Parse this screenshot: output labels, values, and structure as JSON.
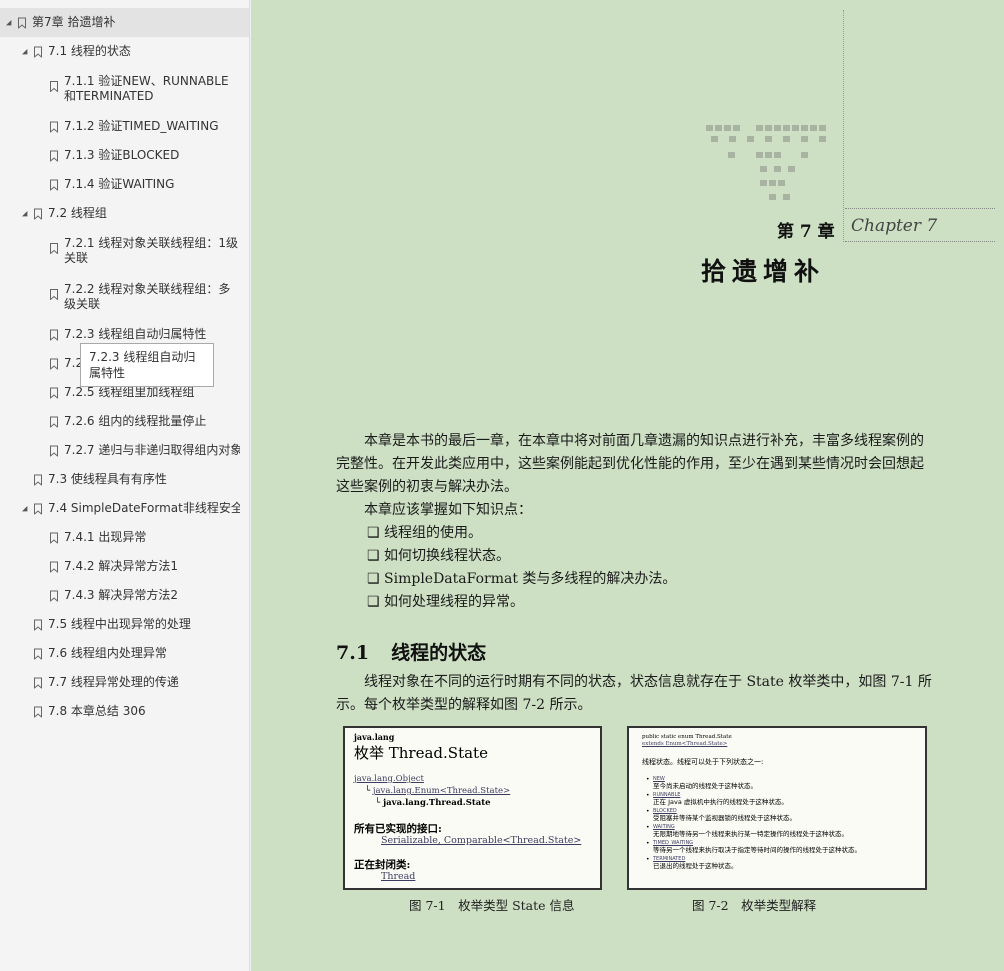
{
  "sidebar": {
    "items": [
      {
        "label": "第7章 拾遗增补",
        "level": 0,
        "expanded": true,
        "selected": true
      },
      {
        "label": "7.1 线程的状态",
        "level": 1,
        "expanded": true
      },
      {
        "label": "7.1.1 验证NEW、RUNNABLE和TERMINATED",
        "level": 2
      },
      {
        "label": "7.1.2 验证TIMED_WAITING",
        "level": 2
      },
      {
        "label": "7.1.3 验证BLOCKED",
        "level": 2
      },
      {
        "label": "7.1.4 验证WAITING",
        "level": 2
      },
      {
        "label": "7.2 线程组",
        "level": 1,
        "expanded": true
      },
      {
        "label": "7.2.1 线程对象关联线程组：1级关联",
        "level": 2
      },
      {
        "label": "7.2.2 线程对象关联线程组：多级关联",
        "level": 2
      },
      {
        "label": "7.2.3 线程组自动归属特性",
        "level": 2
      },
      {
        "label": "7.2.4 获取根线程组",
        "level": 2
      },
      {
        "label": "7.2.5 线程组里加线程组",
        "level": 2
      },
      {
        "label": "7.2.6 组内的线程批量停止",
        "level": 2
      },
      {
        "label": "7.2.7 递归与非递归取得组内对象",
        "level": 2
      },
      {
        "label": "7.3 使线程具有有序性",
        "level": 1
      },
      {
        "label": "7.4 SimpleDateFormat非线程安全",
        "level": 1,
        "expanded": true
      },
      {
        "label": "7.4.1 出现异常",
        "level": 2
      },
      {
        "label": "7.4.2 解决异常方法1",
        "level": 2
      },
      {
        "label": "7.4.3 解决异常方法2",
        "level": 2
      },
      {
        "label": "7.5 线程中出现异常的处理",
        "level": 1
      },
      {
        "label": "7.6 线程组内处理异常",
        "level": 1
      },
      {
        "label": "7.7 线程异常处理的传递",
        "level": 1
      },
      {
        "label": "7.8 本章总结 306",
        "level": 1
      }
    ],
    "tooltip": "7.2.3 线程组自动归属特性"
  },
  "page": {
    "chapter_label": "第 7 章",
    "chapter_script": "Chapter 7",
    "chapter_title": "拾遗增补",
    "intro_p1": "本章是本书的最后一章，在本章中将对前面几章遗漏的知识点进行补充，丰富多线程案例的完整性。在开发此类应用中，这些案例能起到优化性能的作用，至少在遇到某些情况时会回想起这些案例的初衷与解决办法。",
    "intro_p2": "本章应该掌握如下知识点：",
    "bullets": [
      "线程组的使用。",
      "如何切换线程状态。",
      "SimpleDataFormat 类与多线程的解决办法。",
      "如何处理线程的异常。"
    ],
    "section_number": "7.1",
    "section_title": "线程的状态",
    "section_p": "线程对象在不同的运行时期有不同的状态，状态信息就存在于 State 枚举类中，如图 7-1 所示。每个枚举类型的解释如图 7-2 所示。",
    "fig1": {
      "pkg": "java.lang",
      "title": "枚举 Thread.State",
      "h1": "java.lang.Object",
      "h2": "java.lang.Enum<Thread.State>",
      "h3": "java.lang.Thread.State",
      "ifaces_label": "所有已实现的接口:",
      "ifaces": "Serializable, Comparable<Thread.State>",
      "enclosing_label": "正在封闭类:",
      "enclosing": "Thread",
      "caption": "图 7-1　枚举类型 State 信息"
    },
    "fig2": {
      "decl1": "public static enum Thread.State",
      "decl2": "extends Enum<Thread.State>",
      "intro": "线程状态。线程可以处于下列状态之一:",
      "states": [
        {
          "name": "NEW",
          "desc": "至今尚未启动的线程处于这种状态。"
        },
        {
          "name": "RUNNABLE",
          "desc": "正在 Java 虚拟机中执行的线程处于这种状态。"
        },
        {
          "name": "BLOCKED",
          "desc": "受阻塞并等待某个监视器锁的线程处于这种状态。"
        },
        {
          "name": "WAITING",
          "desc": "无限期地等待另一个线程来执行某一特定操作的线程处于这种状态。"
        },
        {
          "name": "TIMED_WAITING",
          "desc": "等待另一个线程来执行取决于指定等待时间的操作的线程处于这种状态。"
        },
        {
          "name": "TERMINATED",
          "desc": "已退出的线程处于这种状态。"
        }
      ],
      "caption": "图 7-2　枚举类型解释"
    }
  }
}
